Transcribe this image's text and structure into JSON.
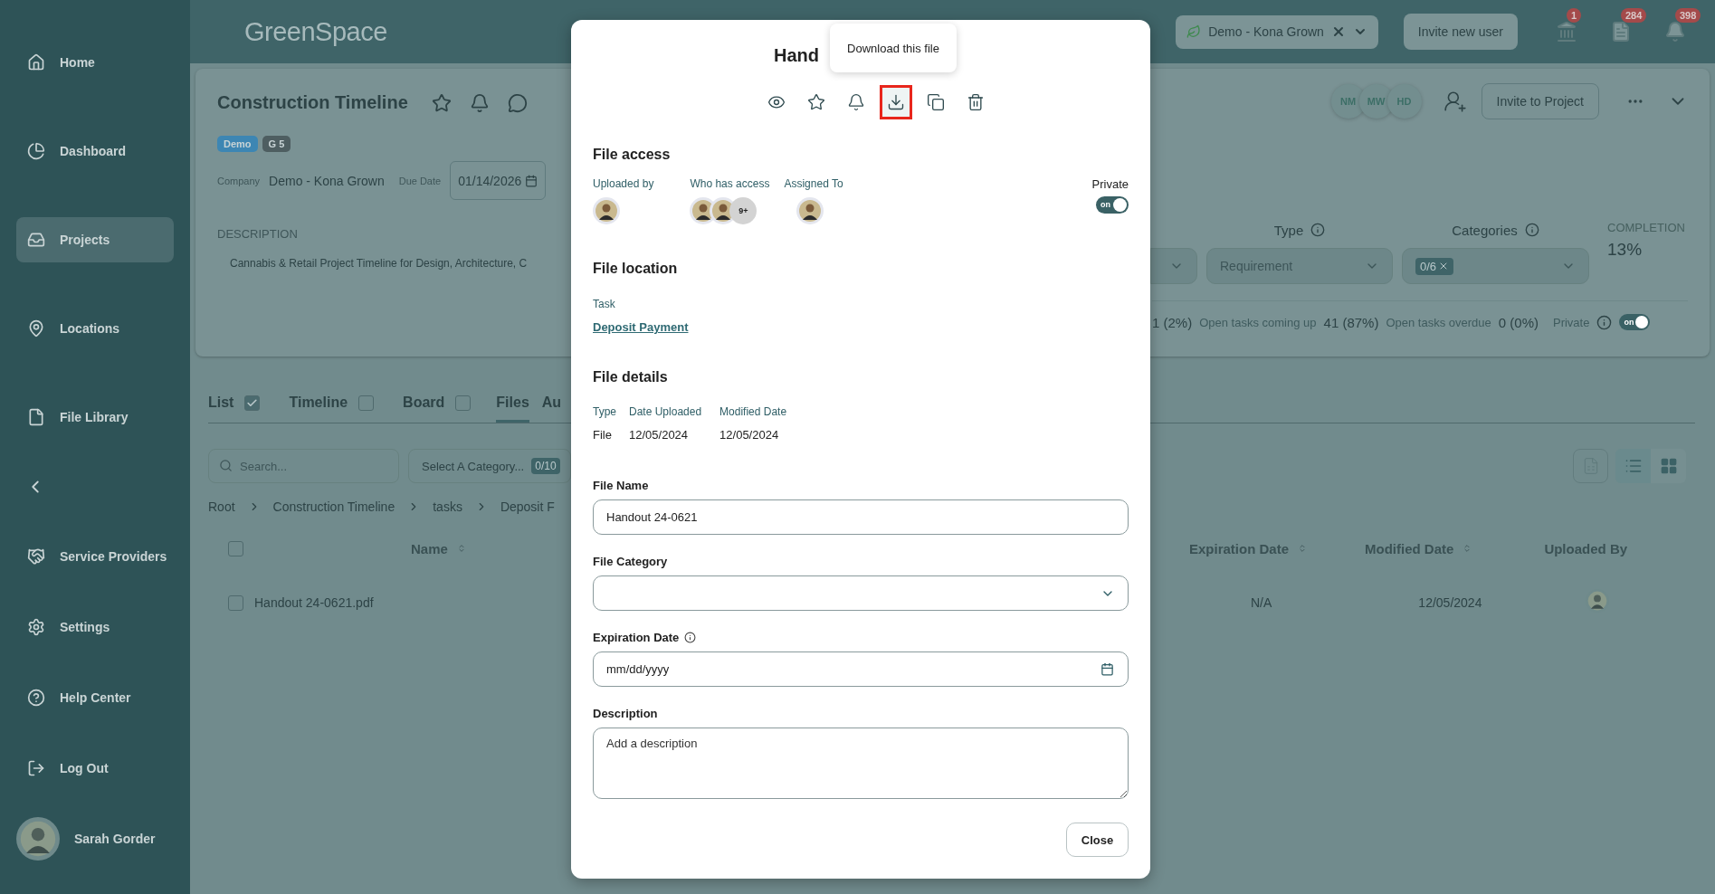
{
  "sidebar": {
    "items": [
      {
        "label": "Home",
        "selected": false
      },
      {
        "label": "Dashboard",
        "selected": false
      },
      {
        "label": "Projects",
        "selected": true
      },
      {
        "label": "Locations",
        "selected": false
      },
      {
        "label": "File Library",
        "selected": false
      }
    ],
    "lower_items": [
      {
        "label": "Service Providers",
        "selected": false
      },
      {
        "label": "Settings",
        "selected": false
      },
      {
        "label": "Help Center",
        "selected": false
      },
      {
        "label": "Log Out",
        "selected": false
      }
    ],
    "user": {
      "name": "Sarah Gorder"
    }
  },
  "header": {
    "logo": "GreenSpace",
    "company": "Demo - Kona Grown",
    "invite_button": "Invite new user",
    "badges": [
      "1",
      "284",
      "398"
    ]
  },
  "project": {
    "title": "Construction Timeline",
    "tags": [
      {
        "label": "Demo",
        "color": "#3d86b3"
      },
      {
        "label": "G 5",
        "color": "#4e5e61"
      }
    ],
    "company_label": "Company",
    "company": "Demo - Kona Grown",
    "due_label": "Due Date",
    "due_date": "01/14/2026",
    "description_label": "DESCRIPTION",
    "description": "Cannabis & Retail Project Timeline for Design, Architecture, C",
    "members": [
      "NM",
      "MW",
      "HD"
    ],
    "invite_button": "Invite to Project",
    "type_label": "Type",
    "type_value": "Requirement",
    "categories_label": "Categories",
    "categories_value": "0/6",
    "completion_label": "COMPLETION",
    "completion": "13%",
    "stats": [
      {
        "kind": "value",
        "text": "1 (2%)"
      },
      {
        "kind": "label",
        "text": "Open tasks coming up"
      },
      {
        "kind": "value",
        "text": "41 (87%)"
      },
      {
        "kind": "label",
        "text": "Open tasks overdue"
      },
      {
        "kind": "value",
        "text": "0 (0%)"
      }
    ],
    "private_label": "Private",
    "private": true,
    "private_text": "on"
  },
  "tabs": [
    {
      "kind": "view",
      "label": "List",
      "checked": true,
      "selected": false
    },
    {
      "kind": "view",
      "label": "Timeline",
      "checked": false,
      "selected": false
    },
    {
      "kind": "view",
      "label": "Board",
      "checked": false,
      "selected": false
    },
    {
      "kind": "page",
      "label": "Files",
      "selected": true
    },
    {
      "kind": "page",
      "label": "Au",
      "selected": false
    }
  ],
  "files": {
    "search_placeholder": "Search...",
    "category_placeholder": "Select A Category...",
    "category_count": "0/10",
    "views": [
      {
        "kind": "list",
        "selected": true
      },
      {
        "kind": "grid",
        "selected": false
      }
    ],
    "breadcrumb": [
      "Root",
      "Construction Timeline",
      "tasks",
      "Deposit F"
    ],
    "columns": [
      "Name",
      "Expiration Date",
      "Modified Date",
      "Uploaded By"
    ],
    "all_checked": false,
    "rows": [
      {
        "name": "Handout 24-0621.pdf",
        "checked": false,
        "expiration": "N/A",
        "modified": "12/05/2024"
      }
    ]
  },
  "modal": {
    "title": "Hand",
    "tooltip": "Download this file",
    "actions": [
      {
        "highlighted": false
      },
      {
        "highlighted": false
      },
      {
        "highlighted": false
      },
      {
        "highlighted": true
      },
      {
        "highlighted": false
      },
      {
        "highlighted": false
      }
    ],
    "access_heading": "File access",
    "uploaded_label": "Uploaded by",
    "access_label": "Who has access",
    "access_more": "9+",
    "assigned_label": "Assigned To",
    "private_label": "Private",
    "private": true,
    "private_text": "on",
    "location_heading": "File location",
    "task_label": "Task",
    "task_link": "Deposit Payment",
    "details_heading": "File details",
    "details": [
      {
        "label": "Type",
        "value": "File"
      },
      {
        "label": "Date Uploaded",
        "value": "12/05/2024"
      },
      {
        "label": "Modified Date",
        "value": "12/05/2024"
      }
    ],
    "fields": [
      {
        "kind": "input",
        "label": "File Name",
        "value": "Handout 24-0621"
      },
      {
        "kind": "select",
        "label": "File Category"
      },
      {
        "kind": "date",
        "label": "Expiration Date",
        "placeholder": "mm/dd/yyyy"
      },
      {
        "kind": "textarea",
        "label": "Description",
        "placeholder": "Add a description"
      }
    ],
    "close_button": "Close"
  }
}
